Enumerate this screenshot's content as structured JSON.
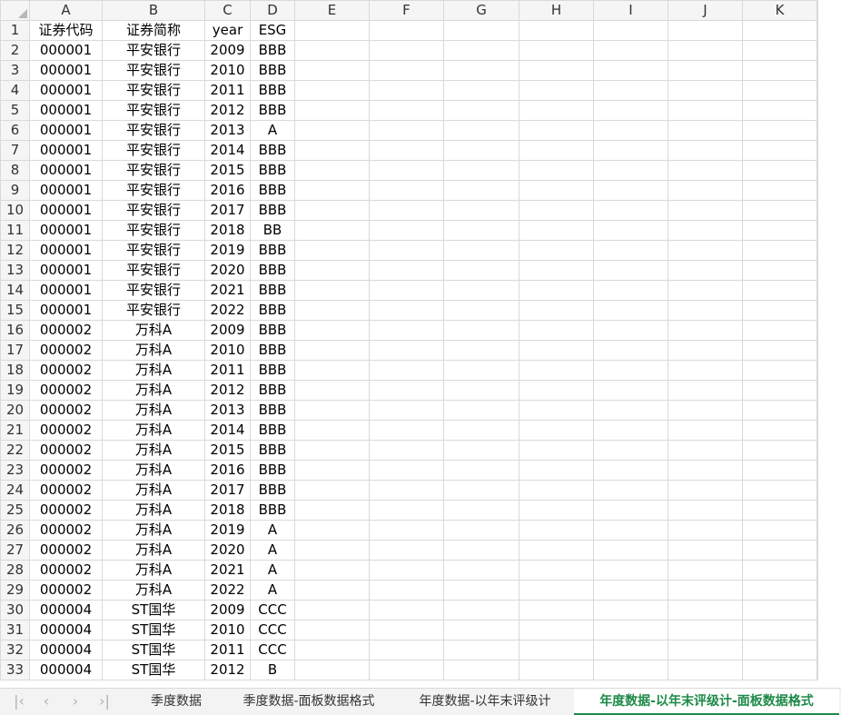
{
  "columns": [
    "A",
    "B",
    "C",
    "D",
    "E",
    "F",
    "G",
    "H",
    "I",
    "J",
    "K"
  ],
  "rows": [
    [
      "证券代码",
      "证券简称",
      "year",
      "ESG"
    ],
    [
      "000001",
      "平安银行",
      "2009",
      "BBB"
    ],
    [
      "000001",
      "平安银行",
      "2010",
      "BBB"
    ],
    [
      "000001",
      "平安银行",
      "2011",
      "BBB"
    ],
    [
      "000001",
      "平安银行",
      "2012",
      "BBB"
    ],
    [
      "000001",
      "平安银行",
      "2013",
      "A"
    ],
    [
      "000001",
      "平安银行",
      "2014",
      "BBB"
    ],
    [
      "000001",
      "平安银行",
      "2015",
      "BBB"
    ],
    [
      "000001",
      "平安银行",
      "2016",
      "BBB"
    ],
    [
      "000001",
      "平安银行",
      "2017",
      "BBB"
    ],
    [
      "000001",
      "平安银行",
      "2018",
      "BB"
    ],
    [
      "000001",
      "平安银行",
      "2019",
      "BBB"
    ],
    [
      "000001",
      "平安银行",
      "2020",
      "BBB"
    ],
    [
      "000001",
      "平安银行",
      "2021",
      "BBB"
    ],
    [
      "000001",
      "平安银行",
      "2022",
      "BBB"
    ],
    [
      "000002",
      "万科A",
      "2009",
      "BBB"
    ],
    [
      "000002",
      "万科A",
      "2010",
      "BBB"
    ],
    [
      "000002",
      "万科A",
      "2011",
      "BBB"
    ],
    [
      "000002",
      "万科A",
      "2012",
      "BBB"
    ],
    [
      "000002",
      "万科A",
      "2013",
      "BBB"
    ],
    [
      "000002",
      "万科A",
      "2014",
      "BBB"
    ],
    [
      "000002",
      "万科A",
      "2015",
      "BBB"
    ],
    [
      "000002",
      "万科A",
      "2016",
      "BBB"
    ],
    [
      "000002",
      "万科A",
      "2017",
      "BBB"
    ],
    [
      "000002",
      "万科A",
      "2018",
      "BBB"
    ],
    [
      "000002",
      "万科A",
      "2019",
      "A"
    ],
    [
      "000002",
      "万科A",
      "2020",
      "A"
    ],
    [
      "000002",
      "万科A",
      "2021",
      "A"
    ],
    [
      "000002",
      "万科A",
      "2022",
      "A"
    ],
    [
      "000004",
      "ST国华",
      "2009",
      "CCC"
    ],
    [
      "000004",
      "ST国华",
      "2010",
      "CCC"
    ],
    [
      "000004",
      "ST国华",
      "2011",
      "CCC"
    ],
    [
      "000004",
      "ST国华",
      "2012",
      "B"
    ]
  ],
  "tabs": {
    "nav_icons": [
      "first-sheet-icon",
      "prev-sheet-icon",
      "next-sheet-icon",
      "last-sheet-icon"
    ],
    "nav_glyphs": [
      "|‹",
      "‹",
      "›",
      "›|"
    ],
    "items": [
      "季度数据",
      "季度数据-面板数据格式",
      "年度数据-以年末评级计",
      "年度数据-以年末评级计-面板数据格式"
    ],
    "active_index": 3
  },
  "colors": {
    "active_tab": "#1e8a48",
    "header_bg": "#f5f5f5",
    "grid": "#d9d9d9"
  }
}
